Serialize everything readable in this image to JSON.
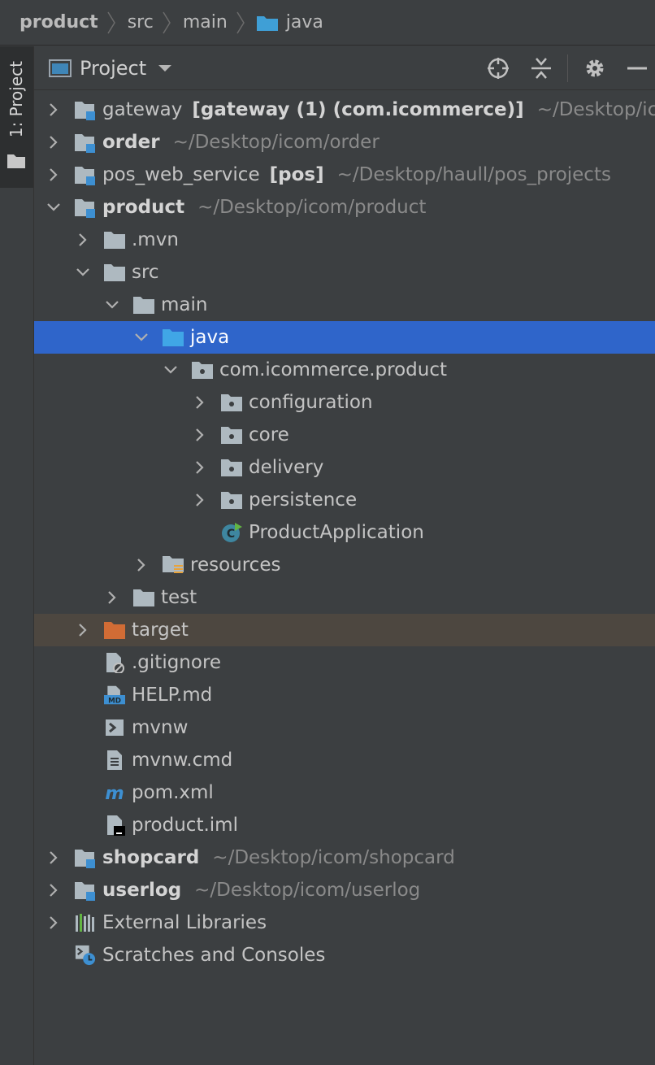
{
  "breadcrumb": [
    "product",
    "src",
    "main",
    "java"
  ],
  "tool_strip": {
    "project_tab_label": "1: Project"
  },
  "panel": {
    "title": "Project"
  },
  "tree": [
    {
      "label": "gateway",
      "extra": "[gateway (1) (com.icommerce)]",
      "path": "~/Desktop/icom/gateway",
      "bold": false,
      "indent": 0,
      "arrow": "right",
      "icon": "module"
    },
    {
      "label": "order",
      "extra": "",
      "path": "~/Desktop/icom/order",
      "bold": true,
      "indent": 0,
      "arrow": "right",
      "icon": "module"
    },
    {
      "label": "pos_web_service",
      "extra": "[pos]",
      "path": "~/Desktop/haull/pos_projects",
      "bold": false,
      "indent": 0,
      "arrow": "right",
      "icon": "module"
    },
    {
      "label": "product",
      "extra": "",
      "path": "~/Desktop/icom/product",
      "bold": true,
      "indent": 0,
      "arrow": "down",
      "icon": "module"
    },
    {
      "label": ".mvn",
      "extra": "",
      "path": "",
      "bold": false,
      "indent": 1,
      "arrow": "right",
      "icon": "folder"
    },
    {
      "label": "src",
      "extra": "",
      "path": "",
      "bold": false,
      "indent": 1,
      "arrow": "down",
      "icon": "folder"
    },
    {
      "label": "main",
      "extra": "",
      "path": "",
      "bold": false,
      "indent": 2,
      "arrow": "down",
      "icon": "folder"
    },
    {
      "label": "java",
      "extra": "",
      "path": "",
      "bold": false,
      "indent": 3,
      "arrow": "down",
      "icon": "source-folder",
      "selected": true
    },
    {
      "label": "com.icommerce.product",
      "extra": "",
      "path": "",
      "bold": false,
      "indent": 4,
      "arrow": "down",
      "icon": "package"
    },
    {
      "label": "configuration",
      "extra": "",
      "path": "",
      "bold": false,
      "indent": 5,
      "arrow": "right",
      "icon": "package"
    },
    {
      "label": "core",
      "extra": "",
      "path": "",
      "bold": false,
      "indent": 5,
      "arrow": "right",
      "icon": "package"
    },
    {
      "label": "delivery",
      "extra": "",
      "path": "",
      "bold": false,
      "indent": 5,
      "arrow": "right",
      "icon": "package"
    },
    {
      "label": "persistence",
      "extra": "",
      "path": "",
      "bold": false,
      "indent": 5,
      "arrow": "right",
      "icon": "package"
    },
    {
      "label": "ProductApplication",
      "extra": "",
      "path": "",
      "bold": false,
      "indent": 5,
      "arrow": "none",
      "icon": "spring-class"
    },
    {
      "label": "resources",
      "extra": "",
      "path": "",
      "bold": false,
      "indent": 3,
      "arrow": "right",
      "icon": "resources-folder"
    },
    {
      "label": "test",
      "extra": "",
      "path": "",
      "bold": false,
      "indent": 2,
      "arrow": "right",
      "icon": "folder"
    },
    {
      "label": "target",
      "extra": "",
      "path": "",
      "bold": false,
      "indent": 1,
      "arrow": "right",
      "icon": "excluded-folder",
      "excluded": true
    },
    {
      "label": ".gitignore",
      "extra": "",
      "path": "",
      "bold": false,
      "indent": 1,
      "arrow": "none",
      "icon": "gitignore-file"
    },
    {
      "label": "HELP.md",
      "extra": "",
      "path": "",
      "bold": false,
      "indent": 1,
      "arrow": "none",
      "icon": "markdown-file"
    },
    {
      "label": "mvnw",
      "extra": "",
      "path": "",
      "bold": false,
      "indent": 1,
      "arrow": "none",
      "icon": "shell-file"
    },
    {
      "label": "mvnw.cmd",
      "extra": "",
      "path": "",
      "bold": false,
      "indent": 1,
      "arrow": "none",
      "icon": "text-file"
    },
    {
      "label": "pom.xml",
      "extra": "",
      "path": "",
      "bold": false,
      "indent": 1,
      "arrow": "none",
      "icon": "maven-file"
    },
    {
      "label": "product.iml",
      "extra": "",
      "path": "",
      "bold": false,
      "indent": 1,
      "arrow": "none",
      "icon": "iml-file"
    },
    {
      "label": "shopcard",
      "extra": "",
      "path": "~/Desktop/icom/shopcard",
      "bold": true,
      "indent": 0,
      "arrow": "right",
      "icon": "module"
    },
    {
      "label": "userlog",
      "extra": "",
      "path": "~/Desktop/icom/userlog",
      "bold": true,
      "indent": 0,
      "arrow": "right",
      "icon": "module"
    },
    {
      "label": "External Libraries",
      "extra": "",
      "path": "",
      "bold": false,
      "indent": 0,
      "arrow": "right",
      "icon": "libraries"
    },
    {
      "label": "Scratches and Consoles",
      "extra": "",
      "path": "",
      "bold": false,
      "indent": 0,
      "arrow": "none",
      "icon": "scratches"
    }
  ]
}
